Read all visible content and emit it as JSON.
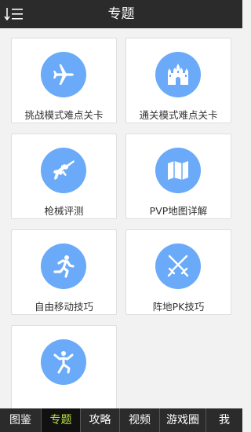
{
  "header": {
    "title": "专题",
    "menu_icon": "sort-list-icon"
  },
  "cards": [
    {
      "label": "挑战模式难点关卡",
      "icon": "airplane-icon"
    },
    {
      "label": "通关模式难点关卡",
      "icon": "castle-icon"
    },
    {
      "label": "枪械评测",
      "icon": "rifle-icon"
    },
    {
      "label": "PVP地图详解",
      "icon": "map-icon"
    },
    {
      "label": "自由移动技巧",
      "icon": "running-person-icon"
    },
    {
      "label": "阵地PK技巧",
      "icon": "crossed-swords-icon"
    },
    {
      "label": "",
      "icon": "kungfu-person-icon"
    }
  ],
  "tabs": [
    {
      "label": "图鉴",
      "active": false
    },
    {
      "label": "专题",
      "active": true
    },
    {
      "label": "攻略",
      "active": false
    },
    {
      "label": "视频",
      "active": false
    },
    {
      "label": "游戏圈",
      "active": false
    },
    {
      "label": "我",
      "active": false
    }
  ],
  "colors": {
    "header_bg": "#2b2b2b",
    "icon_circle": "#6aaaf8",
    "active_tab_text": "#b6e13a",
    "background": "#f2f2f2"
  }
}
